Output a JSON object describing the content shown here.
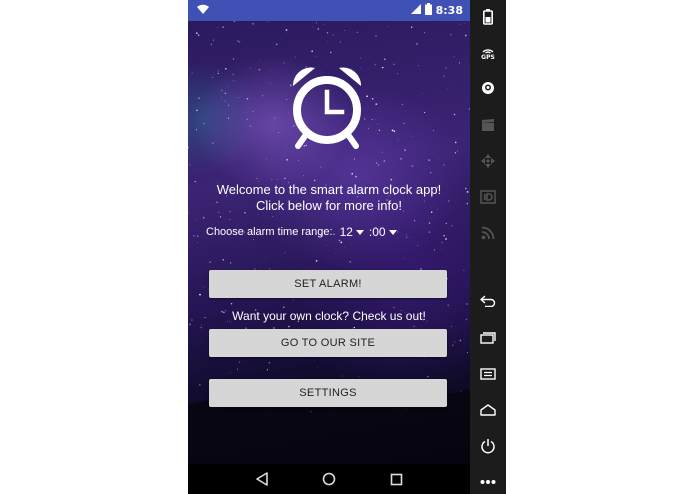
{
  "status_bar": {
    "time": "8:38",
    "icons": [
      "wifi-icon",
      "signal-icon",
      "battery-icon"
    ]
  },
  "main": {
    "logo_icon": "alarm-clock-icon",
    "welcome_line1": "Welcome to the smart alarm clock app!",
    "welcome_line2": "Click below for more info!",
    "time_label": "Choose alarm time range:",
    "hour_value": "12",
    "minute_value": ":00",
    "set_alarm_label": "SET ALARM!",
    "promo_text": "Want your own clock? Check us out!",
    "site_label": "GO TO OUR SITE",
    "settings_label": "SETTINGS"
  },
  "nav_bar": {
    "icons": [
      "back-icon",
      "home-icon",
      "recents-icon"
    ]
  },
  "emulator_sidebar": {
    "gps_label": "GPS",
    "icons": [
      "battery-icon",
      "gps-icon",
      "camera-icon",
      "clapper-icon",
      "dpad-icon",
      "id-icon",
      "rss-icon",
      "back-icon",
      "recents-icon",
      "menu-icon",
      "home-icon",
      "power-icon",
      "more-icon"
    ]
  },
  "colors": {
    "status_bar": "#3f51b5",
    "button_bg": "#d6d6d6",
    "sidebar_bg": "#1c1c1c"
  }
}
